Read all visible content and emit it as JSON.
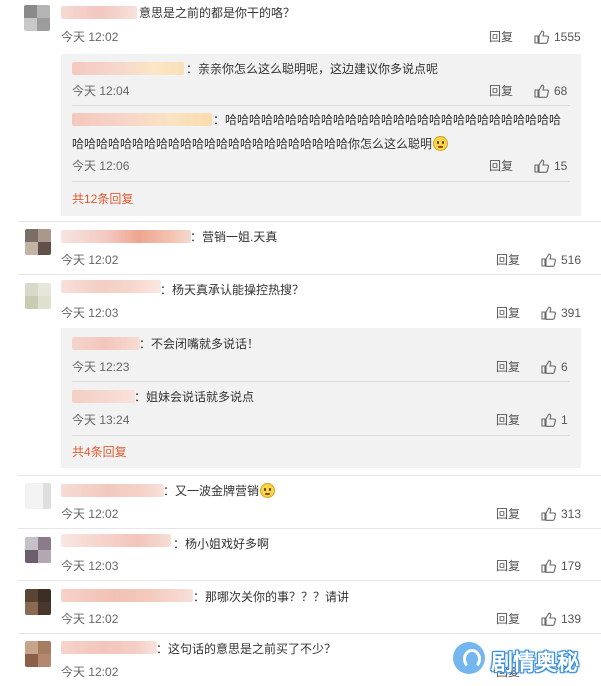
{
  "comments": [
    {
      "id": "c1",
      "text": "意思是之前的都是你干的咯？",
      "time": "今天 12:02",
      "reply": "回复",
      "likes": "1555",
      "replies": [
        {
          "text": "：亲亲你怎么这么聪明呢，这边建议你多说点呢",
          "time": "今天 12:04",
          "reply": "回复",
          "likes": "68"
        },
        {
          "text_line1": "：哈哈哈哈哈哈哈哈哈哈哈哈哈哈哈哈哈哈哈哈哈哈哈哈哈哈哈哈",
          "text_line2": "哈哈哈哈哈哈哈哈哈哈哈哈哈哈哈哈哈哈哈哈哈哈哈你怎么这么聪明",
          "time": "今天 12:06",
          "reply": "回复",
          "likes": "15"
        }
      ],
      "more": "共12条回复"
    },
    {
      "id": "c2",
      "text": "：营销一姐.天真",
      "time": "今天 12:02",
      "reply": "回复",
      "likes": "516"
    },
    {
      "id": "c3",
      "text": "：杨天真承认能操控热搜？",
      "time": "今天 12:03",
      "reply": "回复",
      "likes": "391",
      "replies": [
        {
          "text": "：不会闭嘴就多说话！",
          "time": "今天 12:23",
          "reply": "回复",
          "likes": "6"
        },
        {
          "text": "：姐妹会说话就多说点",
          "time": "今天 13:24",
          "reply": "回复",
          "likes": "1"
        }
      ],
      "more": "共4条回复"
    },
    {
      "id": "c4",
      "text": "：又一波金牌营销",
      "time": "今天 12:02",
      "reply": "回复",
      "likes": "313"
    },
    {
      "id": "c5",
      "text": "：杨小姐戏好多啊",
      "time": "今天 12:03",
      "reply": "回复",
      "likes": "179"
    },
    {
      "id": "c6",
      "text": "：那哪次关你的事？？？请讲",
      "time": "今天 12:02",
      "reply": "回复",
      "likes": "139"
    },
    {
      "id": "c7",
      "text": "：这句话的意思是之前买了不少？",
      "time": "今天 12:02",
      "reply": "回复"
    }
  ],
  "watermark": {
    "text": "剧情奥秘"
  },
  "icons": {
    "like": "thumbs-up-icon",
    "emoji_smile": "smile-emoji-icon",
    "watermark_logo": "drama-logo-icon"
  },
  "colors": {
    "more_link": "#e25b30",
    "sub_bg": "#f2f2f2",
    "watermark": "#3a8fd8"
  }
}
